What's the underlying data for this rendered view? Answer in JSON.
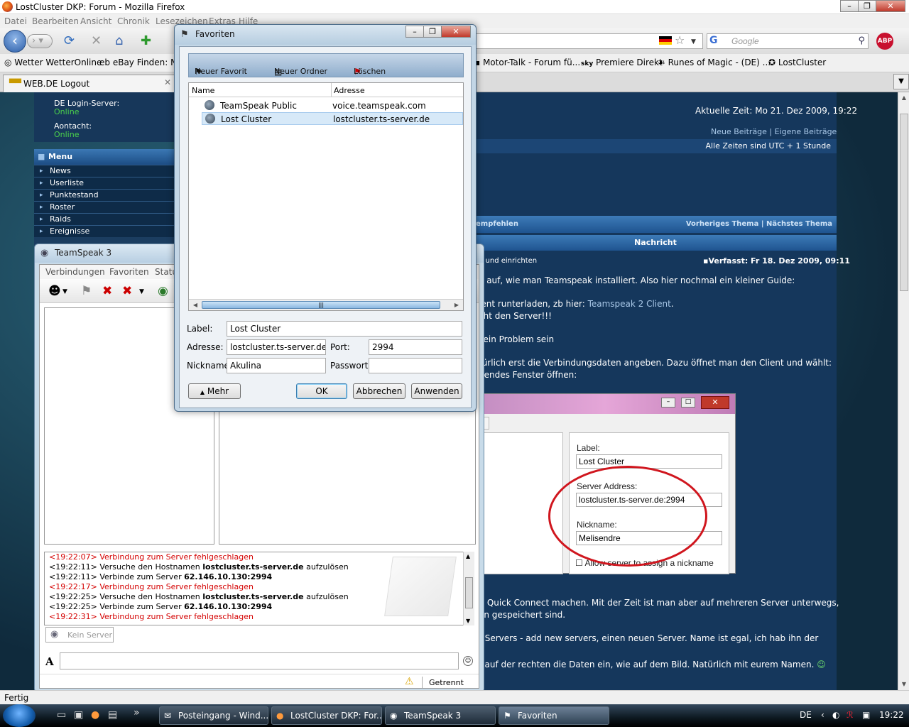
{
  "browser": {
    "title": "LostCluster DKP: Forum - Mozilla Firefox",
    "menu": [
      "Datei",
      "Bearbeiten",
      "Ansicht",
      "Chronik",
      "Lesezeichen",
      "Extras",
      "Hilfe"
    ],
    "search_placeholder": "Google",
    "abp_label": "ABP",
    "bookmarks": [
      "Wetter WetterOnline",
      "eBay Finden: Na",
      "Motor-Talk - Forum fü...",
      "Premiere Direkt",
      "Runes of Magic - (DE) ...",
      "LostCluster"
    ],
    "bookmark_prefix_sky": "sky",
    "tab_label": "WEB.DE Logout",
    "status": "Fertig"
  },
  "forum": {
    "login_server_label": "DE Login-Server:",
    "login_server_value": "Online",
    "aontacht_label": "Aontacht:",
    "aontacht_value": "Online",
    "menu_title": "Menu",
    "menu_items": [
      "News",
      "Userliste",
      "Punktestand",
      "Roster",
      "Raids",
      "Ereignisse"
    ],
    "current_time": "Aktuelle Zeit: Mo 21. Dez 2009, 19:22",
    "new_posts": "Neue Beiträge",
    "own_posts": "Eigene Beiträge",
    "timezone": "Alle Zeiten sind UTC + 1 Stunde",
    "recommend": "empfehlen",
    "prev_topic": "Vorheriges Thema",
    "next_topic": "Nächstes Thema",
    "message_header": "Nachricht",
    "post_subject": "n und einrichten",
    "post_date": "Verfasst: Fr 18. Dez 2009, 09:11",
    "lines": [
      "e auf, wie man Teamspeak installiert. Also hier nochmal ein kleiner Guide:",
      "ient runterladen, zb hier: ",
      "cht den Server!!!",
      "kein Problem sein",
      "türlich erst die Verbindungsdaten angeben. Dazu öffnet man den Client und wählt:",
      "gendes Fenster öffnen:",
      "it Quick Connect machen. Mit der Zeit ist man aber auf mehreren Server unterwegs,",
      "on gespeichert sind.",
      "r Servers - add new servers, einen neuen Server. Name ist egal, ich hab ihn der",
      "t.",
      "t auf der rechten die Daten ein, wie auf dem Bild. Natürlich mit eurem Namen."
    ],
    "client_link": "Teamspeak 2 Client",
    "image": {
      "label_caption": "Label:",
      "label_value": "Lost Cluster",
      "address_caption": "Server Address:",
      "address_value": "lostcluster.ts-server.de:2994",
      "nick_caption": "Nickname:",
      "nick_value": "Melisendre",
      "checkbox": "Allow server to assign a nickname"
    }
  },
  "ts3": {
    "title": "TeamSpeak 3",
    "menu": [
      "Verbindungen",
      "Favoriten",
      "Status"
    ],
    "log": [
      {
        "time": "<19:22:07>",
        "text": "Verbindung zum Server fehlgeschlagen",
        "error": true
      },
      {
        "time": "<19:22:11>",
        "text": "Versuche den Hostnamen ",
        "bold": "lostcluster.ts-server.de",
        "tail": " aufzulösen",
        "error": false
      },
      {
        "time": "<19:22:11>",
        "text": "Verbinde zum Server ",
        "bold": "62.146.10.130:2994",
        "tail": "",
        "error": false
      },
      {
        "time": "<19:22:17>",
        "text": "Verbindung zum Server fehlgeschlagen",
        "error": true
      },
      {
        "time": "<19:22:25>",
        "text": "Versuche den Hostnamen ",
        "bold": "lostcluster.ts-server.de",
        "tail": " aufzulösen",
        "error": false
      },
      {
        "time": "<19:22:25>",
        "text": "Verbinde zum Server ",
        "bold": "62.146.10.130:2994",
        "tail": "",
        "error": false
      },
      {
        "time": "<19:22:31>",
        "text": "Verbindung zum Server fehlgeschlagen",
        "error": true
      }
    ],
    "server_tab": "Kein Server",
    "format_glyph": "A",
    "status": "Getrennt"
  },
  "favorites": {
    "title": "Favoriten",
    "new_favorite": "Neuer Favorit",
    "new_folder": "Neuer Ordner",
    "delete": "Löschen",
    "col_name": "Name",
    "col_address": "Adresse",
    "rows": [
      {
        "name": "TeamSpeak Public",
        "address": "voice.teamspeak.com"
      },
      {
        "name": "Lost Cluster",
        "address": "lostcluster.ts-server.de"
      }
    ],
    "label_caption": "Label:",
    "label_value": "Lost Cluster",
    "address_caption": "Adresse:",
    "address_value": "lostcluster.ts-server.de",
    "port_caption": "Port:",
    "port_value": "2994",
    "nick_caption": "Nickname:",
    "nick_value": "Akulina",
    "password_caption": "Passwort:",
    "password_value": "",
    "more": "Mehr",
    "ok": "OK",
    "cancel": "Abbrechen",
    "apply": "Anwenden"
  },
  "taskbar": {
    "tasks": [
      "Posteingang - Wind...",
      "LostCluster DKP: For...",
      "TeamSpeak 3",
      "Favoriten"
    ],
    "lang": "DE",
    "clock": "19:22"
  }
}
